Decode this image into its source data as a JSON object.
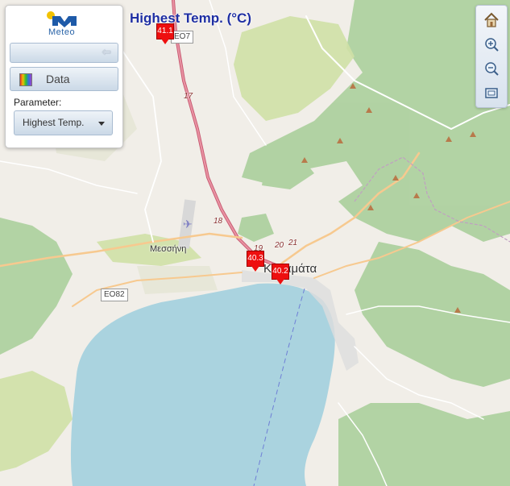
{
  "map": {
    "title": "Highest Temp. (°C)",
    "places": [
      {
        "name": "Μεσσήνη"
      },
      {
        "name": "Καλαμάτα"
      }
    ],
    "route_shields": [
      {
        "label": "EO82"
      },
      {
        "label": "EO7"
      }
    ],
    "road_numbers": [
      "17",
      "18",
      "19",
      "20",
      "21"
    ],
    "stations": [
      {
        "value": "41.1",
        "color": "#ee0f0f"
      },
      {
        "value": "40.3",
        "color": "#ee0f0f"
      },
      {
        "value": "40.2",
        "color": "#ee0f0f"
      }
    ]
  },
  "panel": {
    "logo_text": "Meteo",
    "collapse_icon": "arrow-left-icon",
    "data_button_label": "Data",
    "parameter_label": "Parameter:",
    "parameter_value": "Highest Temp."
  },
  "toolbar": {
    "tools": [
      {
        "icon": "home-icon"
      },
      {
        "icon": "zoom-in-icon"
      },
      {
        "icon": "zoom-out-icon"
      },
      {
        "icon": "zoom-extent-icon"
      }
    ]
  }
}
